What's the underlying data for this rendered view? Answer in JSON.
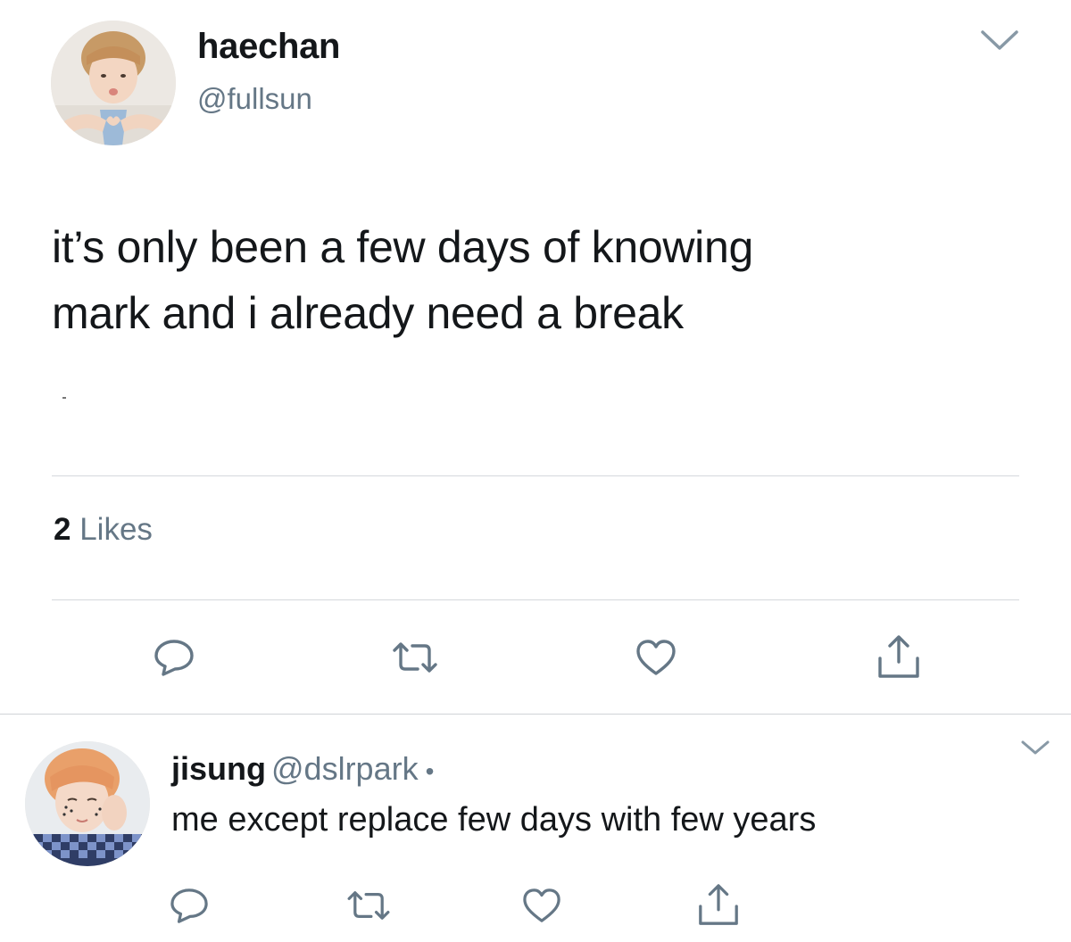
{
  "tweet": {
    "display_name": "haechan",
    "handle": "@fullsun",
    "avatar_icon": "profile-avatar",
    "text_line_1": "it’s only been a few days of knowing",
    "text_line_2": "mark and i already need a break",
    "likes_count": "2",
    "likes_label": "Likes",
    "menu_icon": "chevron-down-icon",
    "actions": [
      "reply-icon",
      "retweet-icon",
      "like-icon",
      "share-icon"
    ]
  },
  "reply": {
    "display_name": "jisung",
    "handle": "@dslrpark",
    "separator": "•",
    "text": "me except replace few days with few years",
    "avatar_icon": "profile-avatar",
    "menu_icon": "chevron-down-icon",
    "actions": [
      "reply-icon",
      "retweet-icon",
      "like-icon",
      "share-icon"
    ]
  },
  "colors": {
    "text_primary": "#14171a",
    "text_secondary": "#657786",
    "icon_gray": "#657786",
    "divider": "#d5d8dc"
  }
}
